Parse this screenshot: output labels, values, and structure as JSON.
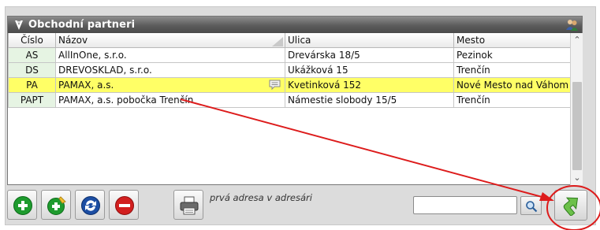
{
  "panel": {
    "title": "Obchodní partneri",
    "title_icon": "app-logo-icon",
    "users_icon": "users-icon"
  },
  "table": {
    "columns": [
      "Číslo",
      "Názov",
      "Ulica",
      "Mesto"
    ],
    "rows": [
      {
        "code": "AS",
        "name": "AllInOne, s.r.o.",
        "street": "Drevárska 18/5",
        "city": "Pezinok"
      },
      {
        "code": "DS",
        "name": "DREVOSKLAD, s.r.o.",
        "street": "Ukážková 15",
        "city": "Trenčín"
      },
      {
        "code": "PA",
        "name": "PAMAX, a.s.",
        "street": "Kvetinková 152",
        "city": "Nové Mesto nad Váhom"
      },
      {
        "code": "PAPT",
        "name": "PAMAX, a.s. pobočka Trenčín",
        "street": "Námestie slobody 15/5",
        "city": "Trenčín"
      }
    ],
    "selected_row_code": "PA",
    "note_icon": "note-icon"
  },
  "toolbar": {
    "hint": "prvá adresa v adresári",
    "search_value": "",
    "buttons": [
      "add-icon",
      "add-edit-icon",
      "refresh-icon",
      "remove-icon",
      "print-icon",
      "search-icon",
      "go-arrow-icon"
    ]
  },
  "colors": {
    "selected_row": "#ffff66",
    "code_cell": "#e6f4e3",
    "annotation": "#dd1b1b"
  }
}
